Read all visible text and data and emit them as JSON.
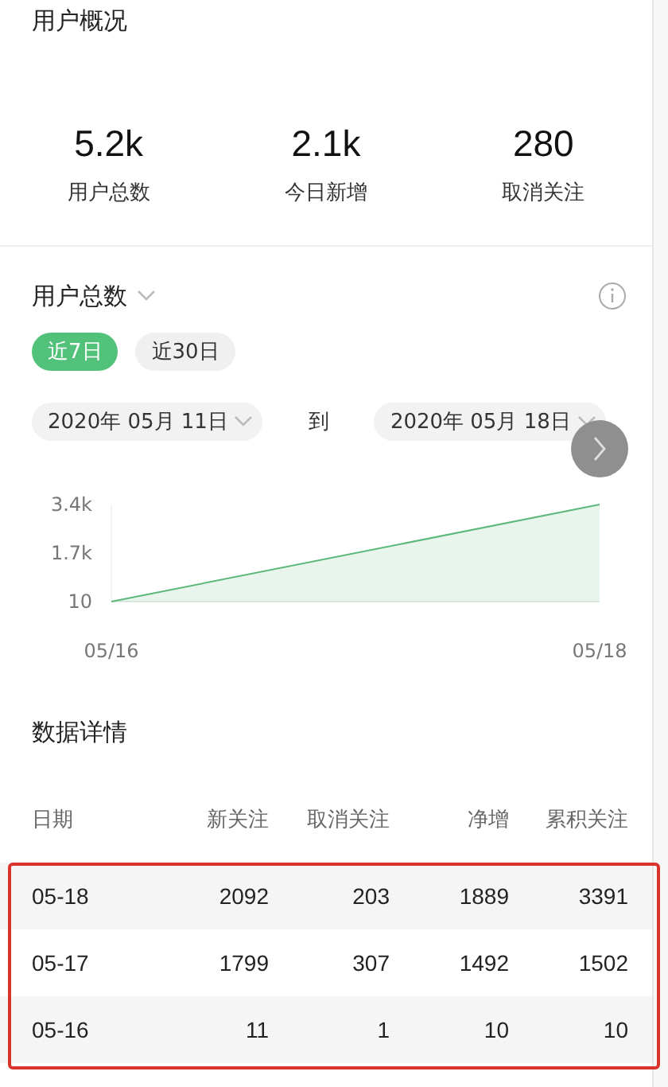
{
  "overview": {
    "title": "用户概况",
    "stats": [
      {
        "value": "5.2k",
        "label": "用户总数"
      },
      {
        "value": "2.1k",
        "label": "今日新增"
      },
      {
        "value": "280",
        "label": "取消关注"
      }
    ]
  },
  "trend": {
    "title": "用户总数",
    "ranges": [
      {
        "label": "近7日",
        "selected": true
      },
      {
        "label": "近30日",
        "selected": false
      }
    ],
    "start_date": "2020年 05月 11日",
    "separator": "到",
    "end_date": "2020年 05月 18日",
    "chart_data": {
      "type": "area",
      "categories": [
        "05/16",
        "05/18"
      ],
      "series": [
        {
          "color": "#5cb87a",
          "values": [
            10,
            3400
          ]
        }
      ],
      "ylim": [
        10,
        3400
      ],
      "yticks": [
        {
          "value": 10,
          "label": "10"
        },
        {
          "value": 1700,
          "label": "1.7k"
        },
        {
          "value": 3400,
          "label": "3.4k"
        }
      ]
    }
  },
  "details": {
    "title": "数据详情",
    "highlighted": true,
    "columns": [
      "日期",
      "新关注",
      "取消关注",
      "净增",
      "累积关注"
    ],
    "rows": [
      [
        "05-18",
        "2092",
        "203",
        "1889",
        "3391"
      ],
      [
        "05-17",
        "1799",
        "307",
        "1492",
        "1502"
      ],
      [
        "05-16",
        "11",
        "1",
        "10",
        "10"
      ]
    ]
  }
}
